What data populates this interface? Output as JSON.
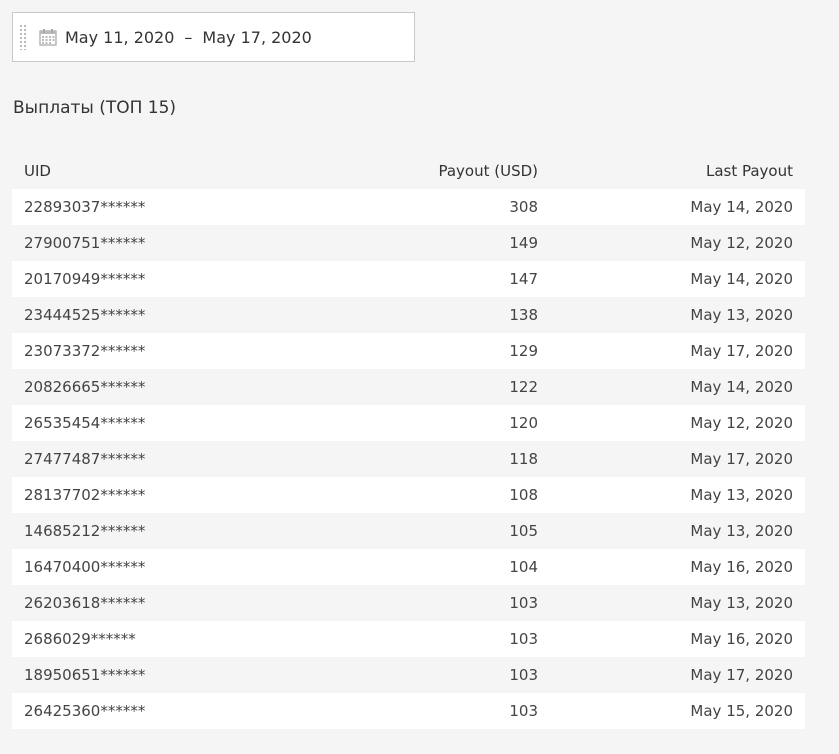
{
  "date_range": {
    "start": "May 11, 2020",
    "separator": "–",
    "end": "May 17, 2020",
    "icon": "calendar-icon"
  },
  "section": {
    "title": "Выплаты (ТОП 15)"
  },
  "table": {
    "headers": {
      "uid": "UID",
      "payout": "Payout (USD)",
      "last_payout": "Last Payout"
    },
    "rows": [
      {
        "uid": "22893037******",
        "payout": "308",
        "last": "May 14, 2020"
      },
      {
        "uid": "27900751******",
        "payout": "149",
        "last": "May 12, 2020"
      },
      {
        "uid": "20170949******",
        "payout": "147",
        "last": "May 14, 2020"
      },
      {
        "uid": "23444525******",
        "payout": "138",
        "last": "May 13, 2020"
      },
      {
        "uid": "23073372******",
        "payout": "129",
        "last": "May 17, 2020"
      },
      {
        "uid": "20826665******",
        "payout": "122",
        "last": "May 14, 2020"
      },
      {
        "uid": "26535454******",
        "payout": "120",
        "last": "May 12, 2020"
      },
      {
        "uid": "27477487******",
        "payout": "118",
        "last": "May 17, 2020"
      },
      {
        "uid": "28137702******",
        "payout": "108",
        "last": "May 13, 2020"
      },
      {
        "uid": "14685212******",
        "payout": "105",
        "last": "May 13, 2020"
      },
      {
        "uid": "16470400******",
        "payout": "104",
        "last": "May 16, 2020"
      },
      {
        "uid": "26203618******",
        "payout": "103",
        "last": "May 13, 2020"
      },
      {
        "uid": "2686029******",
        "payout": "103",
        "last": "May 16, 2020"
      },
      {
        "uid": "18950651******",
        "payout": "103",
        "last": "May 17, 2020"
      },
      {
        "uid": "26425360******",
        "payout": "103",
        "last": "May 15, 2020"
      }
    ]
  }
}
